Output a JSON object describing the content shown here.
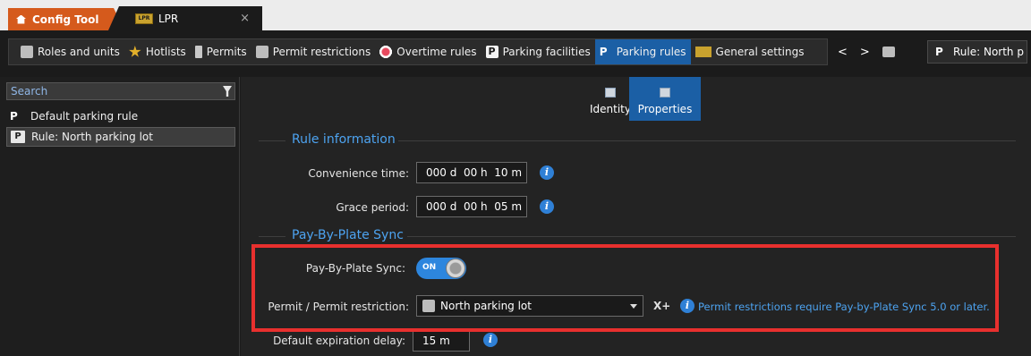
{
  "tabs": [
    {
      "label": "Config Tool"
    },
    {
      "label": "LPR",
      "close": "×"
    }
  ],
  "toolbar": {
    "items": [
      {
        "label": "Roles and units",
        "icon": "roles-icon"
      },
      {
        "label": "Hotlists",
        "icon": "hotlist-star-icon"
      },
      {
        "label": "Permits",
        "icon": "permit-icon"
      },
      {
        "label": "Permit restrictions",
        "icon": "permit-restriction-icon"
      },
      {
        "label": "Overtime rules",
        "icon": "overtime-icon"
      },
      {
        "label": "Parking facilities",
        "icon": "parking-facility-icon"
      },
      {
        "label": "Parking rules",
        "icon": "parking-rule-icon",
        "active": true
      },
      {
        "label": "General settings",
        "icon": "lpr-icon"
      }
    ],
    "back": "<",
    "forward": ">",
    "crumb": "Rule: North p"
  },
  "left": {
    "search_placeholder": "Search",
    "items": [
      {
        "label": "Default parking rule",
        "selected": false
      },
      {
        "label": "Rule: North parking lot",
        "selected": true
      }
    ]
  },
  "main": {
    "tabs": [
      {
        "label": "Identity",
        "active": false
      },
      {
        "label": "Properties",
        "active": true
      }
    ],
    "rule_info": {
      "title": "Rule information",
      "convenience_label": "Convenience time:",
      "convenience_value": "000 d  00 h  10 m",
      "grace_label": "Grace period:",
      "grace_value": "000 d  00 h  05 m"
    },
    "pbp": {
      "title": "Pay-By-Plate Sync",
      "sync_label": "Pay-By-Plate Sync:",
      "toggle": "ON",
      "permit_label": "Permit / Permit restriction:",
      "permit_value": "North parking lot",
      "note": "Permit restrictions require Pay-by-Plate Sync 5.0 or later.",
      "expiration_label": "Default expiration delay:",
      "expiration_value": "15 m"
    }
  },
  "colors": {
    "accent": "#1b5fa5",
    "link": "#4da3f0",
    "highlight": "#e8302e",
    "config_tab": "#d55a1c"
  }
}
